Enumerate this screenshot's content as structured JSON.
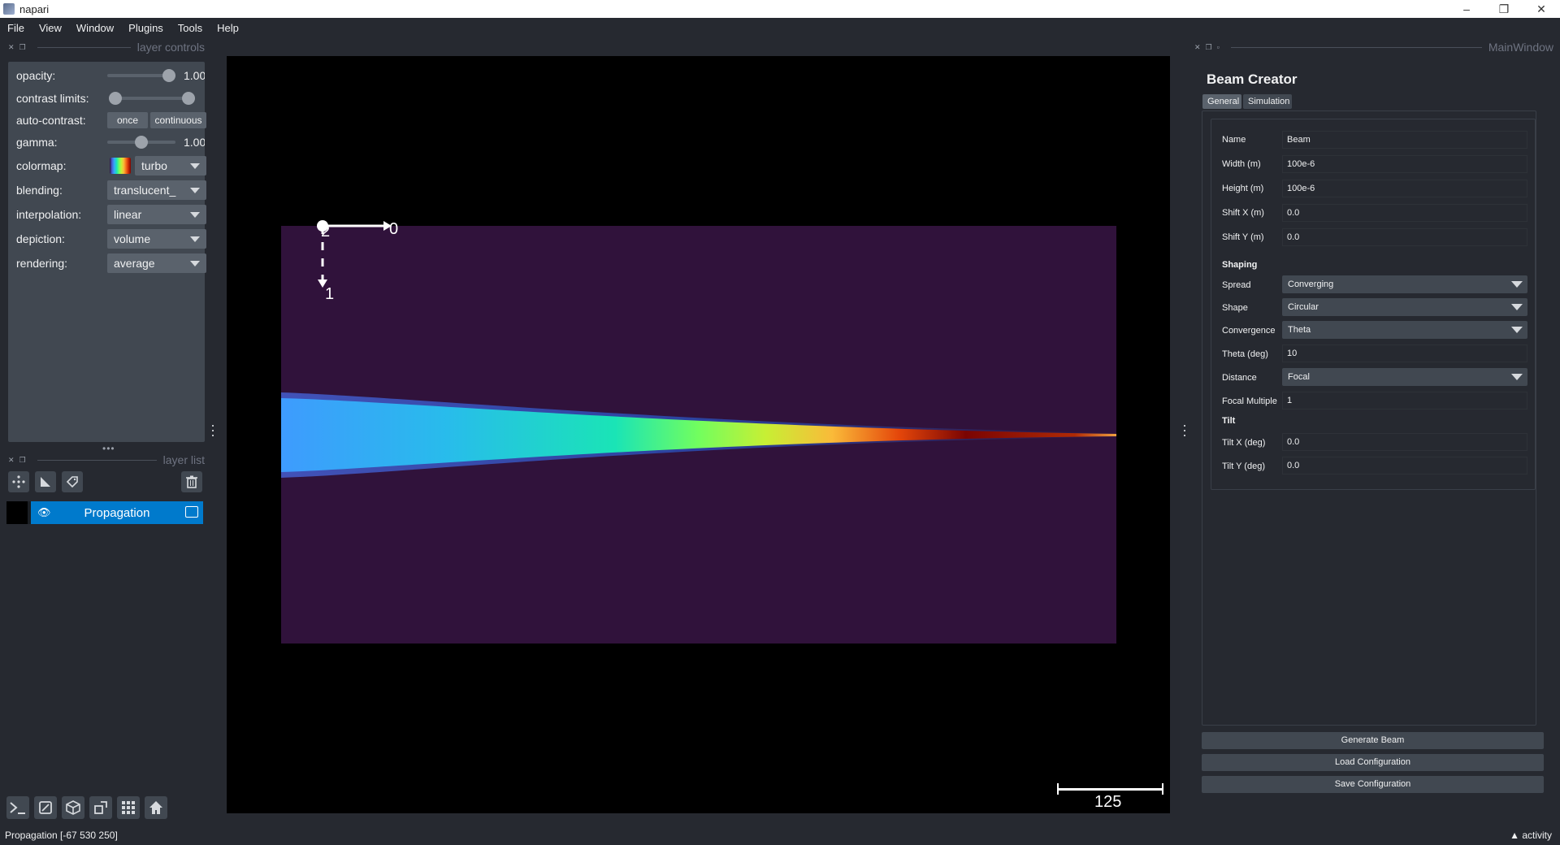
{
  "window": {
    "title": "napari",
    "controls": [
      "–",
      "❐",
      "✕"
    ]
  },
  "menu": [
    "File",
    "View",
    "Window",
    "Plugins",
    "Tools",
    "Help"
  ],
  "layer_controls": {
    "header": "layer controls",
    "opacity": {
      "label": "opacity:",
      "value": "1.00",
      "fraction": 1.0
    },
    "contrast_limits": {
      "label": "contrast limits:",
      "low_fraction": 0.0,
      "high_fraction": 1.0
    },
    "auto_contrast": {
      "label": "auto-contrast:",
      "once": "once",
      "continuous": "continuous"
    },
    "gamma": {
      "label": "gamma:",
      "value": "1.00",
      "fraction": 0.5
    },
    "colormap": {
      "label": "colormap:",
      "value": "turbo"
    },
    "blending": {
      "label": "blending:",
      "value": "translucent_"
    },
    "interpolation": {
      "label": "interpolation:",
      "value": "linear"
    },
    "depiction": {
      "label": "depiction:",
      "value": "volume"
    },
    "rendering": {
      "label": "rendering:",
      "value": "average"
    }
  },
  "layer_list": {
    "header": "layer list",
    "layers": [
      {
        "name": "Propagation",
        "visible": true,
        "selected": true
      }
    ]
  },
  "canvas": {
    "axes": {
      "x_label": "0",
      "y_label": "1",
      "z_label": "2"
    },
    "scale_bar": "125"
  },
  "status": {
    "left": "Propagation [-67 530 250]",
    "right": "activity"
  },
  "right_dock": {
    "header": "MainWindow",
    "title": "Beam Creator",
    "tabs": [
      {
        "label": "General",
        "active": true
      },
      {
        "label": "Simulation",
        "active": false
      }
    ],
    "fields": {
      "name": {
        "label": "Name",
        "value": "Beam"
      },
      "width": {
        "label": "Width (m)",
        "value": "100e-6"
      },
      "height": {
        "label": "Height (m)",
        "value": "100e-6"
      },
      "shift_x": {
        "label": "Shift X (m)",
        "value": "0.0"
      },
      "shift_y": {
        "label": "Shift Y (m)",
        "value": "0.0"
      },
      "shaping_section": "Shaping",
      "spread": {
        "label": "Spread",
        "value": "Converging"
      },
      "shape": {
        "label": "Shape",
        "value": "Circular"
      },
      "convergence": {
        "label": "Convergence",
        "value": "Theta"
      },
      "theta": {
        "label": "Theta (deg)",
        "value": "10"
      },
      "distance": {
        "label": "Distance",
        "value": "Focal"
      },
      "focal_multiple": {
        "label": "Focal Multiple",
        "value": "1"
      },
      "tilt_section": "Tilt",
      "tilt_x": {
        "label": "Tilt X (deg)",
        "value": "0.0"
      },
      "tilt_y": {
        "label": "Tilt Y (deg)",
        "value": "0.0"
      }
    },
    "buttons": {
      "generate": "Generate Beam",
      "load": "Load Configuration",
      "save": "Save Configuration"
    }
  },
  "colors": {
    "background": "#262930",
    "foreground": "#414851",
    "selection": "#007acc",
    "image_bg": "#30123b"
  }
}
